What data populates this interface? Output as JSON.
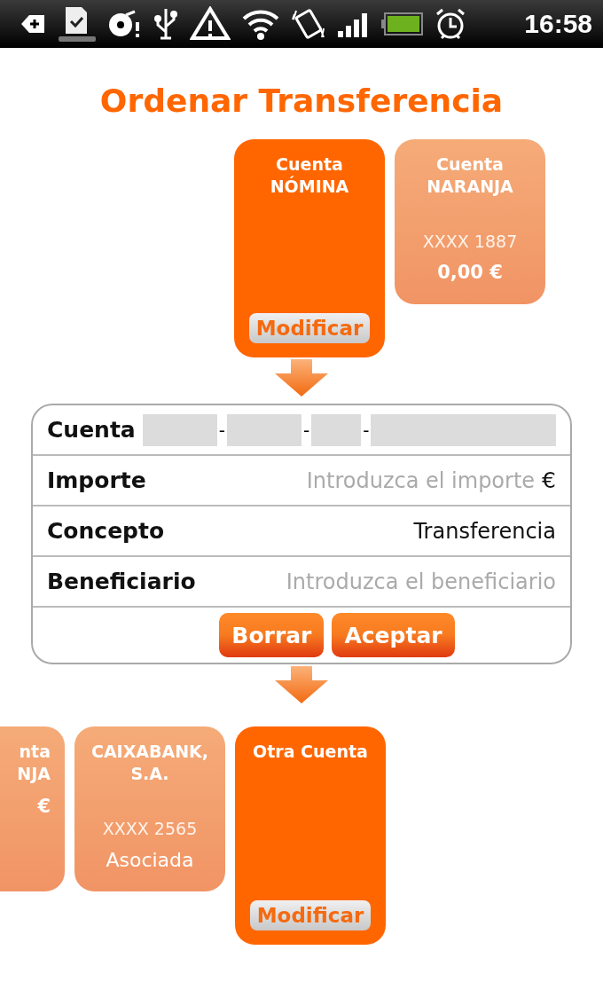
{
  "status_bar": {
    "time": "16:58"
  },
  "title": "Ordenar Transferencia",
  "source_accounts": [
    {
      "lines": [
        "Cuenta",
        "NÓMINA"
      ],
      "selected": true,
      "button": "Modificar"
    },
    {
      "lines": [
        "Cuenta",
        "NARANJA"
      ],
      "number": "XXXX 1887",
      "balance": "0,00 €",
      "selected": false
    }
  ],
  "form": {
    "account": {
      "label": "Cuenta",
      "parts": [
        {
          "kind": "masked"
        },
        {
          "kind": "separator",
          "text": "-"
        },
        {
          "kind": "masked"
        },
        {
          "kind": "separator",
          "text": "-"
        },
        {
          "kind": "masked"
        },
        {
          "kind": "separator",
          "text": "-"
        },
        {
          "kind": "masked"
        }
      ]
    },
    "rows": [
      {
        "label": "Importe",
        "placeholder": "Introduzca el importe",
        "suffix": "€"
      },
      {
        "label": "Concepto",
        "value": "Transferencia"
      },
      {
        "label": "Beneficiario",
        "placeholder": "Introduzca el beneficiario"
      }
    ],
    "buttons": [
      "Borrar",
      "Aceptar"
    ]
  },
  "destination_accounts": [
    {
      "kind": "partial",
      "lines": [
        "nta",
        "NJA"
      ],
      "balance": "€",
      "selected": false
    },
    {
      "kind": "full",
      "lines": [
        "CAIXABANK,",
        "S.A."
      ],
      "number": "XXXX 2565",
      "status": "Asociada",
      "selected": false
    },
    {
      "kind": "full",
      "lines": [
        "Otra Cuenta"
      ],
      "selected": true,
      "button": "Modificar"
    }
  ]
}
